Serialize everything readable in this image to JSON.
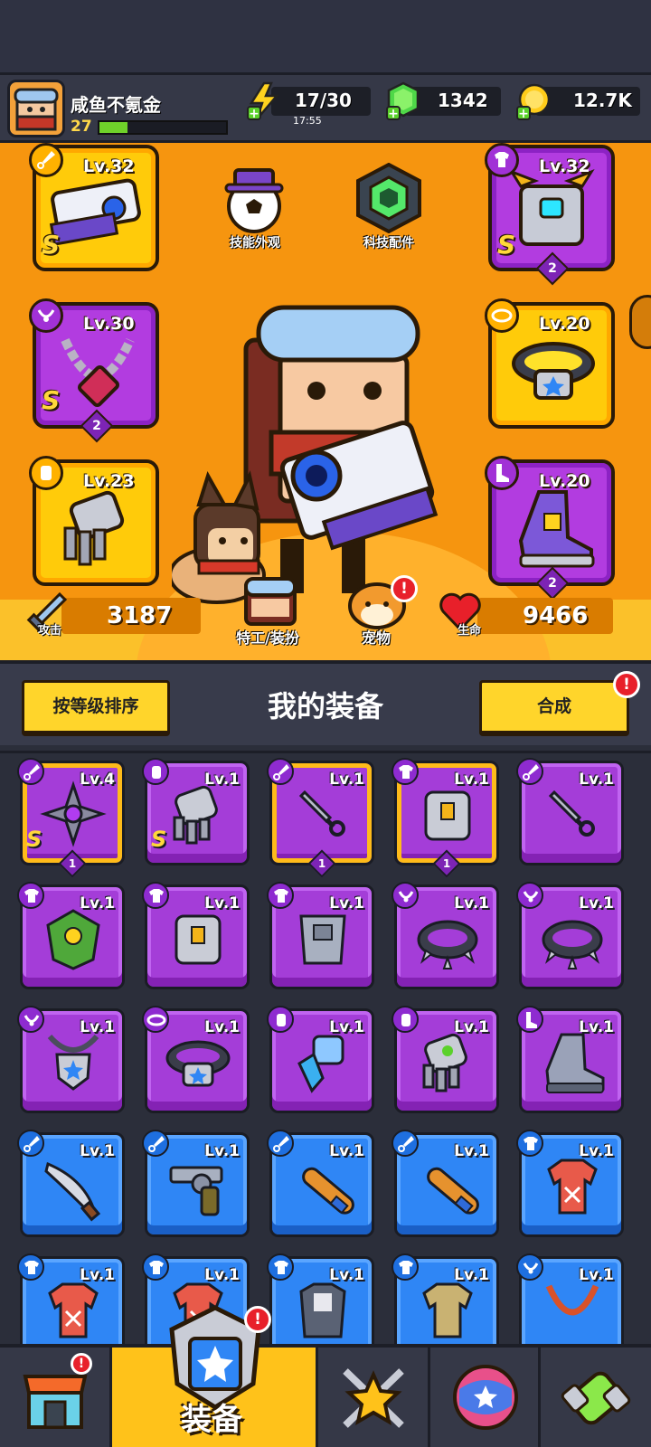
{
  "player": {
    "name": "咸鱼不氪金",
    "level": "27",
    "xp_fraction": 0.22
  },
  "resources": {
    "energy": "17/30",
    "energy_timer": "17:55",
    "gems": "1342",
    "gold": "12.7K"
  },
  "hero_slots": {
    "weapon": {
      "level": "Lv.32",
      "rank": "S"
    },
    "armor": {
      "level": "Lv.32",
      "rank": "S",
      "stack": "2"
    },
    "necklace": {
      "level": "Lv.30",
      "rank": "S",
      "stack": "2"
    },
    "belt": {
      "level": "Lv.20"
    },
    "gloves": {
      "level": "Lv.23"
    },
    "boots": {
      "level": "Lv.20",
      "stack": "2"
    }
  },
  "hero_menu": {
    "skill_skin": "技能外观",
    "tech_parts": "科技配件",
    "agent_outfit": "特工/装扮",
    "pet": "宠物"
  },
  "stats": {
    "attack_label": "攻击",
    "attack_value": "3187",
    "hp_label": "生命",
    "hp_value": "9466"
  },
  "equipment": {
    "title": "我的装备",
    "sort_button": "按等级排序",
    "merge_button": "合成"
  },
  "inventory": [
    {
      "lv": "Lv.4",
      "rarity": "purple-gold",
      "rank": "S",
      "stack": "1",
      "icon": "shuriken-weapon-icon"
    },
    {
      "lv": "Lv.1",
      "rarity": "purple",
      "rank": "S",
      "icon": "gauntlet-icon"
    },
    {
      "lv": "Lv.1",
      "rarity": "purple-gold",
      "stack": "1",
      "icon": "kunai-icon"
    },
    {
      "lv": "Lv.1",
      "rarity": "purple-gold",
      "stack": "1",
      "icon": "armor-vest-icon"
    },
    {
      "lv": "Lv.1",
      "rarity": "purple",
      "icon": "kunai-icon"
    },
    {
      "lv": "Lv.1",
      "rarity": "purple",
      "icon": "leaf-armor-icon"
    },
    {
      "lv": "Lv.1",
      "rarity": "purple",
      "icon": "armor-vest-icon"
    },
    {
      "lv": "Lv.1",
      "rarity": "purple",
      "icon": "plate-armor-icon"
    },
    {
      "lv": "Lv.1",
      "rarity": "purple",
      "icon": "spiked-collar-icon"
    },
    {
      "lv": "Lv.1",
      "rarity": "purple",
      "icon": "spiked-collar-icon"
    },
    {
      "lv": "Lv.1",
      "rarity": "purple",
      "icon": "badge-necklace-icon"
    },
    {
      "lv": "Lv.1",
      "rarity": "purple",
      "icon": "belt-icon"
    },
    {
      "lv": "Lv.1",
      "rarity": "purple",
      "icon": "claw-glove-icon"
    },
    {
      "lv": "Lv.1",
      "rarity": "purple",
      "icon": "robot-glove-icon"
    },
    {
      "lv": "Lv.1",
      "rarity": "purple",
      "icon": "boot-icon"
    },
    {
      "lv": "Lv.1",
      "rarity": "blue",
      "icon": "machete-icon"
    },
    {
      "lv": "Lv.1",
      "rarity": "blue",
      "icon": "revolver-icon"
    },
    {
      "lv": "Lv.1",
      "rarity": "blue",
      "icon": "bat-icon"
    },
    {
      "lv": "Lv.1",
      "rarity": "blue",
      "icon": "bat-icon"
    },
    {
      "lv": "Lv.1",
      "rarity": "blue",
      "icon": "shirt-icon"
    },
    {
      "lv": "Lv.1",
      "rarity": "blue",
      "icon": "shirt-icon"
    },
    {
      "lv": "Lv.1",
      "rarity": "blue",
      "icon": "shirt-icon"
    },
    {
      "lv": "Lv.1",
      "rarity": "blue",
      "icon": "vest-icon"
    },
    {
      "lv": "Lv.1",
      "rarity": "blue",
      "icon": "khaki-shirt-icon"
    },
    {
      "lv": "Lv.1",
      "rarity": "blue",
      "icon": "rope-necklace-icon"
    }
  ],
  "nav": {
    "equip_label": "装备",
    "alert": "!"
  }
}
